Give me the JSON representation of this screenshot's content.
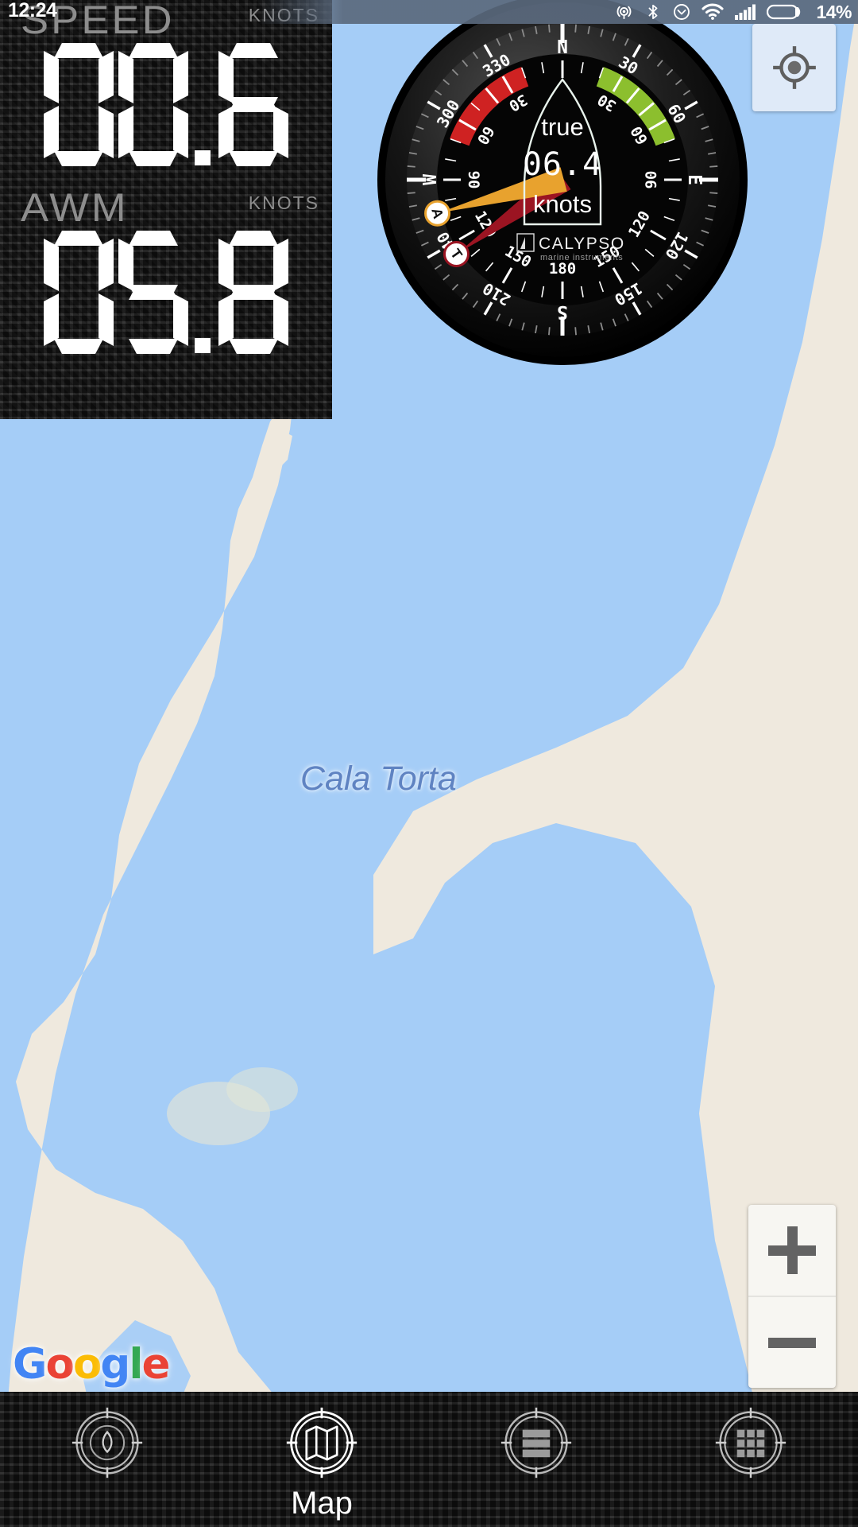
{
  "status_bar": {
    "clock": "12:24",
    "battery_percent": "14%",
    "icons": [
      "gps-icon",
      "bluetooth-icon",
      "alarm-icon",
      "wifi-icon",
      "cellular-signal-icon",
      "battery-icon"
    ]
  },
  "instruments": [
    {
      "title": "SPEED",
      "unit": "KNOTS",
      "value": "00.6"
    },
    {
      "title": "AWM",
      "unit": "KNOTS",
      "value": "05.8"
    }
  ],
  "gauge": {
    "brand": "CALYPSO",
    "brand_sub": "marine instruments",
    "readout_label": "true",
    "readout_value": "06.4",
    "readout_unit": "knots",
    "needles": [
      {
        "id": "true-wind-needle",
        "label": "T",
        "angle_deg": 235,
        "color": "#9b1422"
      },
      {
        "id": "apparent-wind-needle",
        "label": "A",
        "angle_deg": 255,
        "color": "#e8a22e"
      }
    ],
    "compass_labels": [
      "N",
      "30",
      "60",
      "E",
      "120",
      "150",
      "S",
      "210",
      "240",
      "W",
      "300",
      "330"
    ],
    "inner_scale_labels": [
      "30",
      "60",
      "90",
      "120",
      "150",
      "180",
      "150",
      "120",
      "90",
      "60",
      "30"
    ],
    "port_arc_color": "#cf2222",
    "starboard_arc_color": "#8cbf2e"
  },
  "map": {
    "place_label": "Cala Torta",
    "attribution": "Google",
    "attribution_letters": [
      {
        "ch": "G",
        "color": "#4285F4"
      },
      {
        "ch": "o",
        "color": "#EA4335"
      },
      {
        "ch": "o",
        "color": "#FBBC05"
      },
      {
        "ch": "g",
        "color": "#4285F4"
      },
      {
        "ch": "l",
        "color": "#34A853"
      },
      {
        "ch": "e",
        "color": "#EA4335"
      }
    ],
    "water_color": "#a5cdf7",
    "land_color": "#efe9de",
    "controls": {
      "locate": "my-location-icon",
      "zoom_in": "+",
      "zoom_out": "−"
    }
  },
  "bottom_nav": {
    "items": [
      {
        "icon": "compass-instrument-icon",
        "label": "",
        "active": false
      },
      {
        "icon": "map-icon",
        "label": "Map",
        "active": true
      },
      {
        "icon": "list-icon",
        "label": "",
        "active": false
      },
      {
        "icon": "grid-icon",
        "label": "",
        "active": false
      }
    ]
  }
}
